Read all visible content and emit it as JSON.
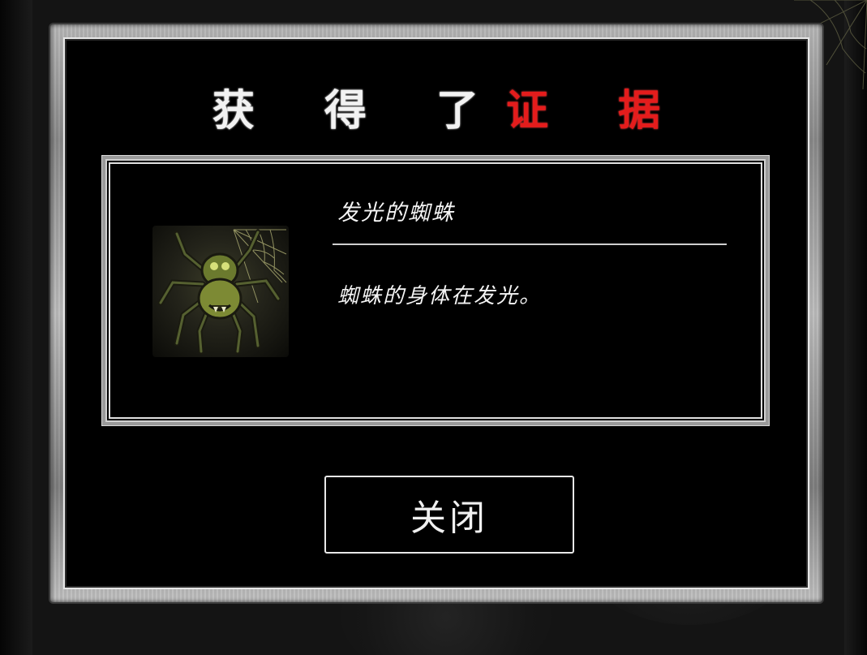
{
  "dialog": {
    "title_main": "获 得 了",
    "title_accent": "证 据"
  },
  "evidence": {
    "name": "发光的蜘蛛",
    "description": "蜘蛛的身体在发光。",
    "image_icon": "glowing-spider"
  },
  "buttons": {
    "close_label": "关闭"
  },
  "colors": {
    "title_text": "#f2f2f2",
    "title_accent": "#e41c1c",
    "panel_bg": "#000000",
    "frame_metal": "#a8a8a8"
  }
}
